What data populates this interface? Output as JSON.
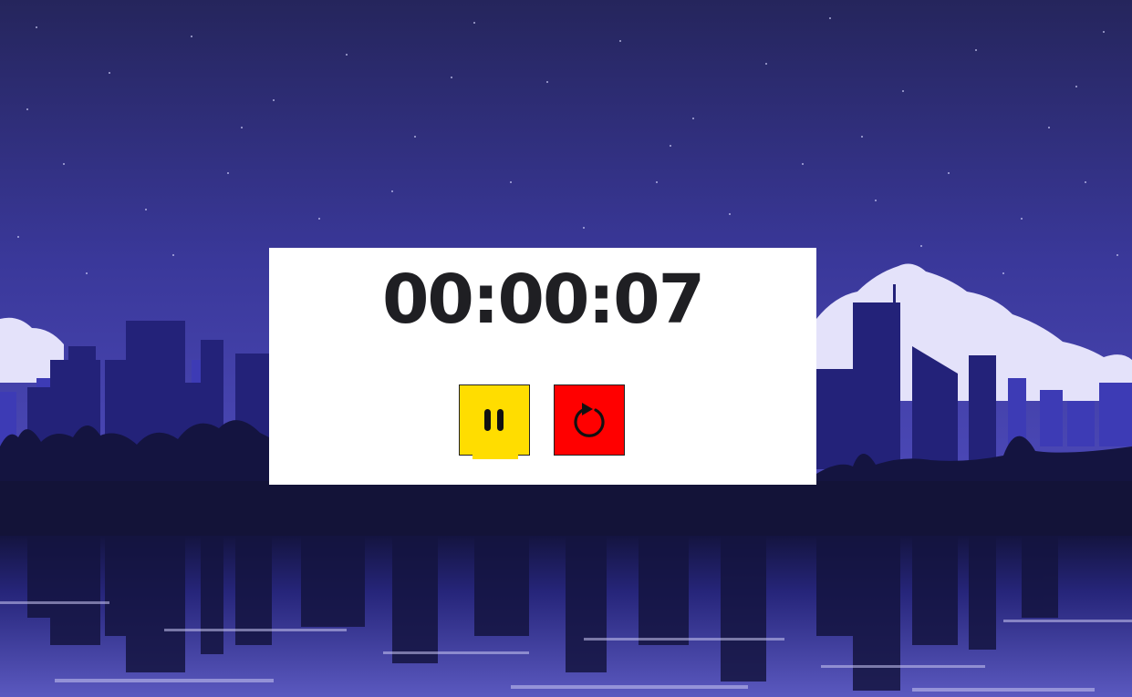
{
  "timer": {
    "display": "00:00:07"
  },
  "controls": {
    "pause_icon": "pause-icon",
    "reset_icon": "restart-icon"
  },
  "colors": {
    "pause_button": "#ffdd00",
    "reset_button": "#ff0000",
    "panel": "#ffffff",
    "time_text": "#1f1f23",
    "sky_top": "#26265e",
    "sky_bottom": "#4a47b3",
    "clouds": "#e6e4fb",
    "city_far": "#3f3db8",
    "city_near": "#23227a",
    "ground": "#131338",
    "water": "#2c2b8c"
  }
}
